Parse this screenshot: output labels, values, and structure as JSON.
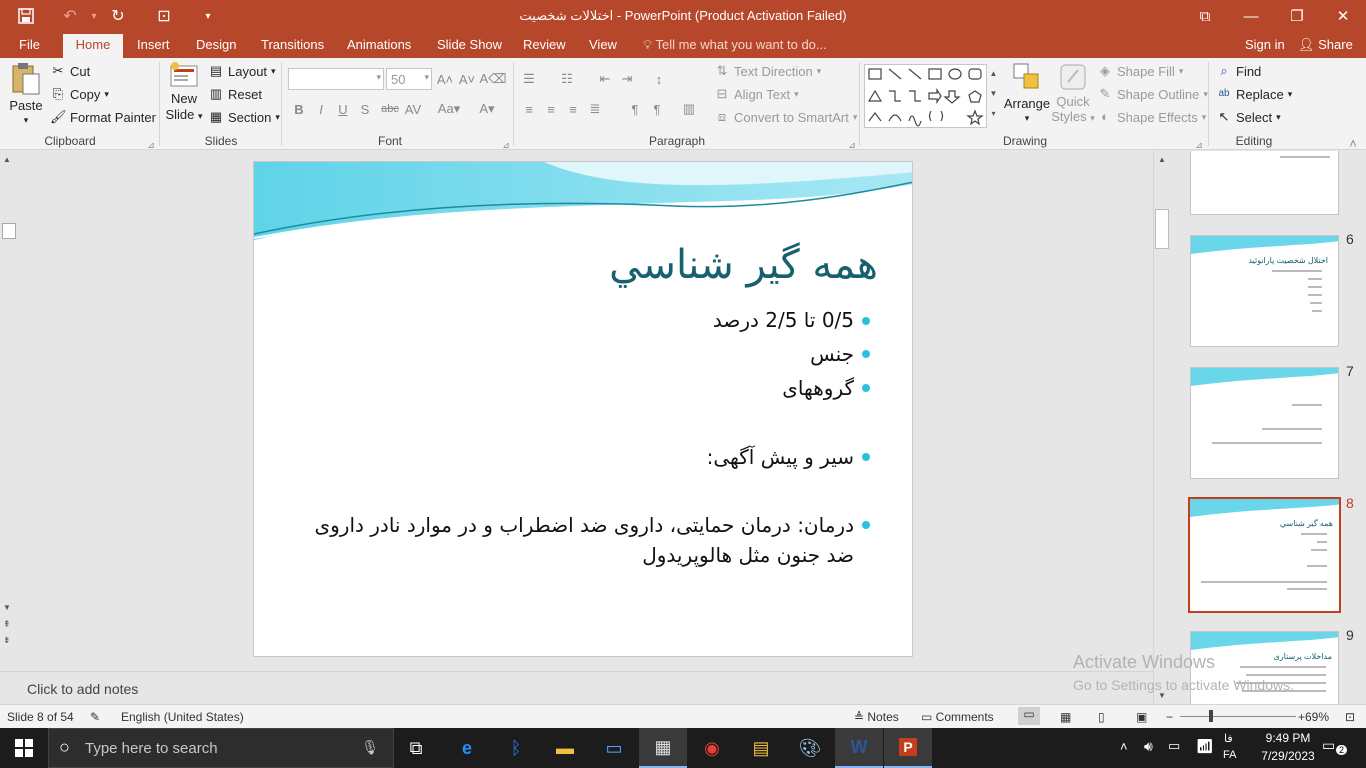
{
  "titlebar": {
    "title": "اختلالات شخصیت - PowerPoint (Product Activation Failed)",
    "save_icon": "save-icon",
    "undo_icon": "undo-icon",
    "redo_icon": "repeat-icon",
    "customize_icon": "presentation-icon",
    "restore_icon": "ribbon-display-icon",
    "minimize": "—",
    "maximize": "❐",
    "close": "✕"
  },
  "tabs": {
    "file": "File",
    "home": "Home",
    "insert": "Insert",
    "design": "Design",
    "transitions": "Transitions",
    "animations": "Animations",
    "slideshow": "Slide Show",
    "review": "Review",
    "view": "View",
    "tellme": "Tell me what you want to do...",
    "signin": "Sign in",
    "share": "Share"
  },
  "ribbon": {
    "clipboard": {
      "paste": "Paste",
      "cut": "Cut",
      "copy": "Copy",
      "format_painter": "Format Painter",
      "label": "Clipboard"
    },
    "slides": {
      "new_slide_line1": "New",
      "new_slide_line2": "Slide",
      "layout": "Layout",
      "reset": "Reset",
      "section": "Section",
      "label": "Slides"
    },
    "font": {
      "font_name": "",
      "font_size": "50",
      "bold": "B",
      "italic": "I",
      "underline": "U",
      "shadow": "S",
      "strike": "abc",
      "label": "Font"
    },
    "paragraph": {
      "text_direction": "Text Direction",
      "align_text": "Align Text",
      "convert_smartart": "Convert to SmartArt",
      "label": "Paragraph"
    },
    "drawing": {
      "arrange": "Arrange",
      "quick_styles_line1": "Quick",
      "quick_styles_line2": "Styles",
      "shape_fill": "Shape Fill",
      "shape_outline": "Shape Outline",
      "shape_effects": "Shape Effects",
      "label": "Drawing"
    },
    "editing": {
      "find": "Find",
      "replace": "Replace",
      "select": "Select",
      "label": "Editing"
    }
  },
  "slide": {
    "title": "همه گیر شناسي",
    "bullets": [
      "0/5 تا 2/5 درصد",
      "جنس",
      "گروههای",
      "سیر و پیش آگهی:",
      "درمان: درمان حمایتی، داروی ضد اضطراب و در موارد نادر داروی",
      "ضد جنون مثل هالوپریدول"
    ]
  },
  "thumbnails": [
    {
      "number": "6",
      "title": "اختلال شخصیت پارانوئید"
    },
    {
      "number": "7",
      "title": ""
    },
    {
      "number": "8",
      "title": "همه گیر شناسي"
    },
    {
      "number": "9",
      "title": "مداخلات پرستاری"
    }
  ],
  "notes": {
    "placeholder": "Click to add notes"
  },
  "statusbar": {
    "slide_info": "Slide 8 of 54",
    "language": "English (United States)",
    "notes": "Notes",
    "comments": "Comments",
    "zoom": "69%"
  },
  "watermark": {
    "line1": "Activate Windows",
    "line2": "Go to Settings to activate Windows."
  },
  "taskbar": {
    "search_placeholder": "Type here to search",
    "time": "9:49 PM",
    "date": "7/29/2023",
    "lang": "FA",
    "lang_script": "فا",
    "notification_count": "2"
  },
  "colors": {
    "accent": "#b7472a",
    "title_color": "#17606e",
    "bullet_color": "#29c2dc",
    "selected_thumb": "#c43e1c"
  }
}
